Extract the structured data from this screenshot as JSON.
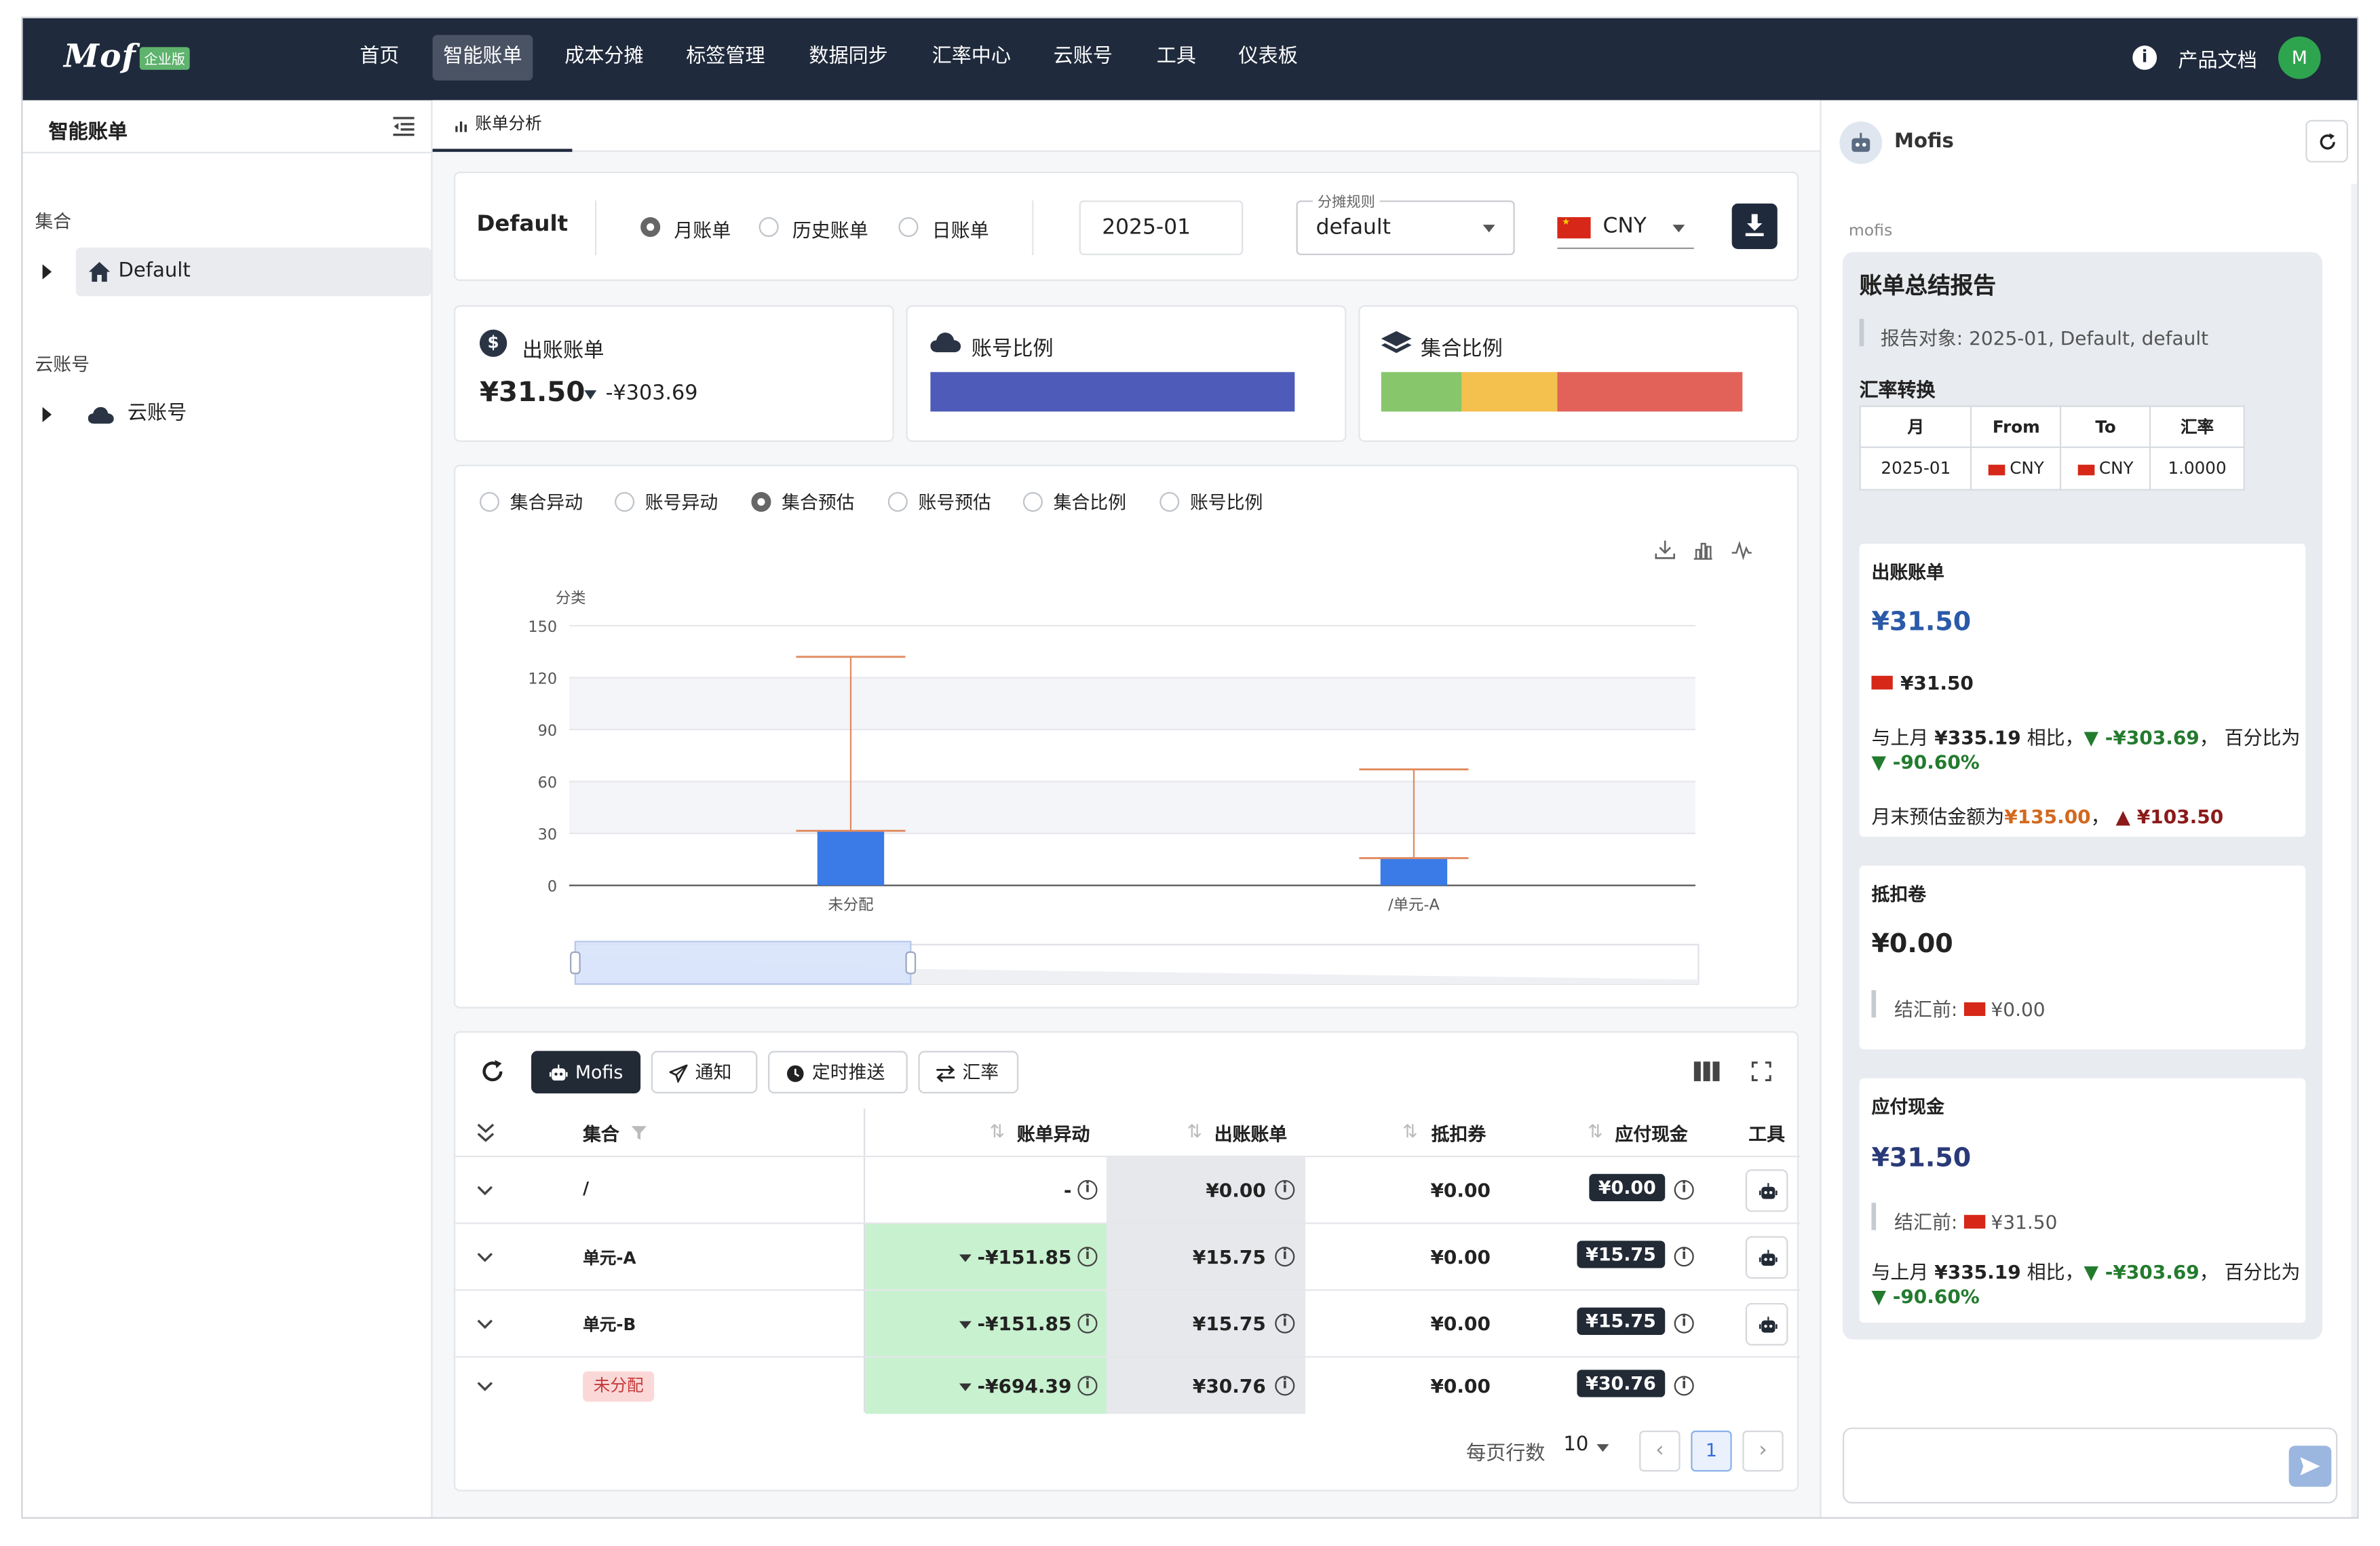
{
  "app": {
    "logo": "Mof",
    "edition_badge": "企业版"
  },
  "nav": {
    "items": [
      "首页",
      "智能账单",
      "成本分摊",
      "标签管理",
      "数据同步",
      "汇率中心",
      "云账号",
      "工具",
      "仪表板"
    ],
    "docs": "产品文档",
    "avatar_initial": "M"
  },
  "sidebar": {
    "title": "智能账单",
    "group_collection": "集合",
    "node_default": "Default",
    "group_cloud": "云账号",
    "node_cloud": "云账号"
  },
  "tabs": {
    "analysis": "账单分析"
  },
  "filters": {
    "collection": "Default",
    "radio_monthly": "月账单",
    "radio_history": "历史账单",
    "radio_daily": "日账单",
    "month": "2025-01",
    "rule_label": "分摊规则",
    "rule_value": "default",
    "currency": "CNY"
  },
  "summary": {
    "bill_title": "出账账单",
    "bill_amount": "¥31.50",
    "bill_change": "-¥303.69",
    "account_ratio_title": "账号比例",
    "collection_ratio_title": "集合比例",
    "collection_ratio_colors": [
      "#88c66c",
      "#f4c04e",
      "#e2625a"
    ]
  },
  "chart_tabs": [
    "集合异动",
    "账号异动",
    "集合预估",
    "账号预估",
    "集合比例",
    "账号比例"
  ],
  "chart_data": {
    "type": "bar",
    "ylabel": "分类",
    "categories": [
      "未分配",
      "/单元-A"
    ],
    "values": [
      31.5,
      15.75
    ],
    "error_high": [
      132,
      67
    ],
    "error_low": [
      31.5,
      15.75
    ],
    "ylim": [
      0,
      150
    ],
    "yticks": [
      0,
      30,
      60,
      90,
      120,
      150
    ],
    "bar_color": "#3b7be8",
    "error_color": "#e08a5e"
  },
  "table": {
    "toolbar": {
      "mofis": "Mofis",
      "notify": "通知",
      "schedule": "定时推送",
      "rate": "汇率"
    },
    "headers": [
      "集合",
      "账单异动",
      "出账账单",
      "抵扣券",
      "应付现金",
      "工具"
    ],
    "rows": [
      {
        "name": "/",
        "change": "-",
        "bill": "¥0.00",
        "voucher": "¥0.00",
        "cash": "¥0.00",
        "tool": true
      },
      {
        "name": "单元-A",
        "change": "-¥151.85",
        "bill": "¥15.75",
        "voucher": "¥0.00",
        "cash": "¥15.75",
        "tool": true
      },
      {
        "name": "单元-B",
        "change": "-¥151.85",
        "bill": "¥15.75",
        "voucher": "¥0.00",
        "cash": "¥15.75",
        "tool": true
      },
      {
        "name": "未分配",
        "change": "-¥694.39",
        "bill": "¥30.76",
        "voucher": "¥0.00",
        "cash": "¥30.76",
        "tool": false
      }
    ],
    "pagination": {
      "rows_per_page_label": "每页行数",
      "rows_per_page": "10",
      "page": "1"
    }
  },
  "assistant": {
    "name": "Mofis",
    "sender": "mofis",
    "report_title": "账单总结报告",
    "report_target_label": "报告对象:",
    "report_target": "2025-01, Default, default",
    "fx_title": "汇率转换",
    "fx_headers": [
      "月",
      "From",
      "To",
      "汇率"
    ],
    "fx_row": [
      "2025-01",
      "CNY",
      "CNY",
      "1.0000"
    ],
    "bill": {
      "title": "出账账单",
      "amount": "¥31.50",
      "native": "¥31.50",
      "cmp_prefix": "与上月",
      "cmp_prev": "¥335.19",
      "cmp_mid": "相比，",
      "cmp_change": "▼ -¥303.69",
      "cmp_pct_label": "， 百分比为",
      "cmp_pct": "▼ -90.60%",
      "forecast_label": "月末预估金额为",
      "forecast": "¥135.00",
      "forecast_sep": "，",
      "forecast_change": "▲ ¥103.50"
    },
    "voucher": {
      "title": "抵扣卷",
      "amount": "¥0.00",
      "pre_label": "结汇前:",
      "pre_value": "¥0.00"
    },
    "cash": {
      "title": "应付现金",
      "amount": "¥31.50",
      "pre_label": "结汇前:",
      "pre_value": "¥31.50",
      "cmp_prefix": "与上月",
      "cmp_prev": "¥335.19",
      "cmp_mid": "相比，",
      "cmp_change": "▼ -¥303.69",
      "cmp_pct_label": "， 百分比为",
      "cmp_pct": "▼ -90.60%"
    }
  }
}
